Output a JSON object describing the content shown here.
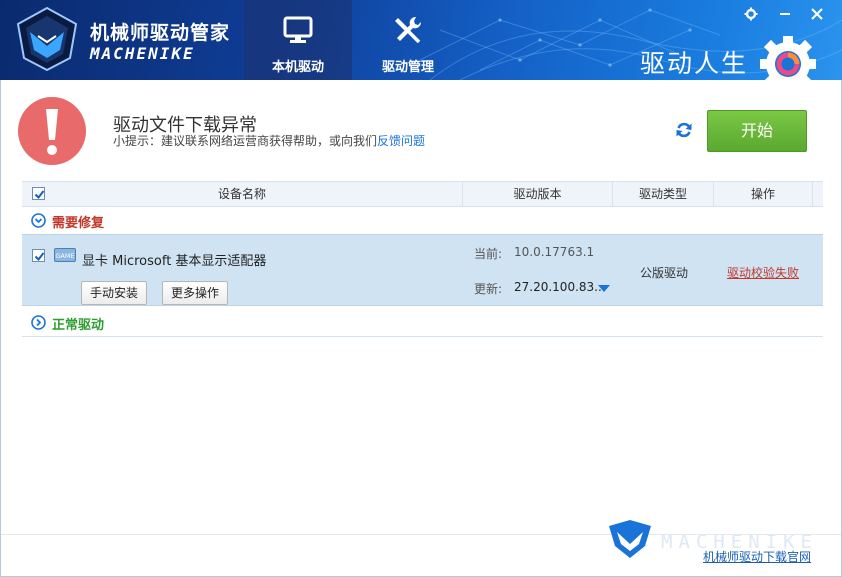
{
  "header": {
    "app_title": "机械师驱动管家",
    "app_brand": "MACHENIKE",
    "tabs": [
      {
        "label": "本机驱动",
        "icon": "monitor-icon",
        "active": true
      },
      {
        "label": "驱动管理",
        "icon": "tools-icon",
        "active": false
      }
    ],
    "slogan": "驱动人生",
    "window_controls": [
      "gear-icon",
      "minimize-icon",
      "close-icon"
    ]
  },
  "alert": {
    "title": "驱动文件下载异常",
    "tip_prefix": "小提示：建议联系网络运营商获得帮助，或向我们",
    "tip_link": "反馈问题",
    "start_button": "开始"
  },
  "table": {
    "columns": [
      "设备名称",
      "驱动版本",
      "驱动类型",
      "操作"
    ]
  },
  "groups": {
    "needs_repair": {
      "label": "需要修复",
      "drivers": [
        {
          "checked": true,
          "icon": "game-gpu-icon",
          "name": "显卡 Microsoft 基本显示适配器",
          "current_label": "当前:",
          "current_version": "10.0.17763.1",
          "update_label": "更新:",
          "update_version": "27.20.100.83...",
          "type": "公版驱动",
          "action": "驱动校验失败",
          "buttons": {
            "manual_install": "手动安装",
            "more_actions": "更多操作"
          }
        }
      ]
    },
    "normal": {
      "label": "正常驱动"
    }
  },
  "footer": {
    "brand": "MACHENIKE",
    "link": "机械师驱动下载官网"
  },
  "colors": {
    "accent_blue": "#1460c6",
    "start_green": "#6ab83a",
    "alert_red": "#e86a6a",
    "repair_red": "#c0392b",
    "normal_green": "#2e9e30",
    "row_highlight": "#cfe3f3"
  }
}
